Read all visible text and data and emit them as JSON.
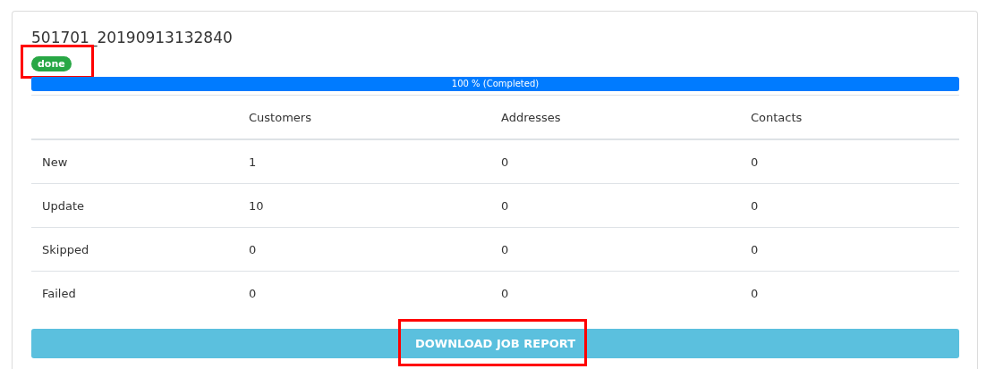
{
  "job": {
    "title": "501701_20190913132840",
    "status": {
      "label": "done",
      "kind": "success",
      "highlighted": true
    },
    "progress": {
      "level": 1,
      "label": "100 % (Completed)"
    },
    "table": {
      "columns": [
        "",
        "Customers",
        "Addresses",
        "Contacts"
      ],
      "rows": [
        [
          "New",
          "1",
          "0",
          "0"
        ],
        [
          "Update",
          "10",
          "0",
          "0"
        ],
        [
          "Skipped",
          "0",
          "0",
          "0"
        ],
        [
          "Failed",
          "0",
          "0",
          "0"
        ]
      ]
    },
    "button": {
      "label": "DOWNLOAD JOB REPORT",
      "highlighted": true
    }
  }
}
